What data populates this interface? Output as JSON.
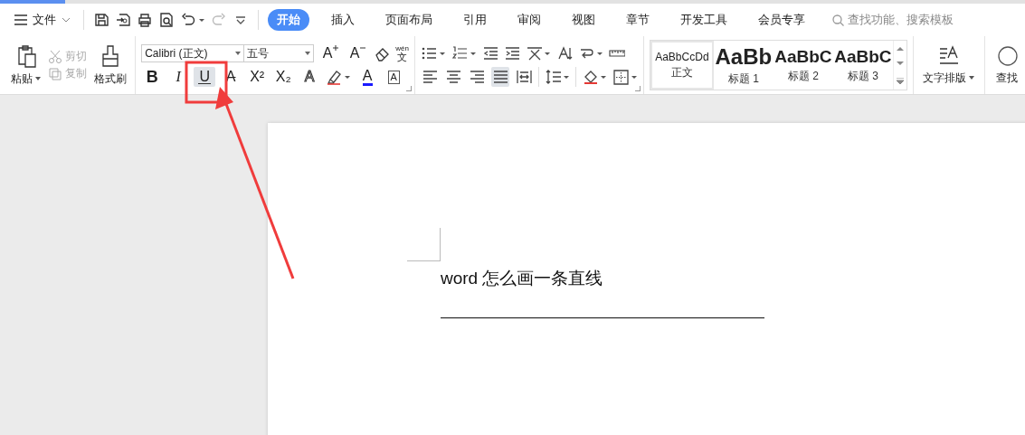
{
  "menu": {
    "file_label": "文件"
  },
  "tabs": [
    {
      "label": "开始",
      "selected": true
    },
    {
      "label": "插入",
      "selected": false
    },
    {
      "label": "页面布局",
      "selected": false
    },
    {
      "label": "引用",
      "selected": false
    },
    {
      "label": "审阅",
      "selected": false
    },
    {
      "label": "视图",
      "selected": false
    },
    {
      "label": "章节",
      "selected": false
    },
    {
      "label": "开发工具",
      "selected": false
    },
    {
      "label": "会员专享",
      "selected": false
    }
  ],
  "search": {
    "placeholder": "查找功能、搜索模板"
  },
  "clipboard": {
    "paste": "粘贴",
    "cut": {
      "label": "剪切",
      "disabled": true
    },
    "copy": {
      "label": "复制",
      "disabled": true
    },
    "format_painter": "格式刷"
  },
  "font": {
    "name": "Calibri (正文)",
    "size": "五号",
    "pinyin_top": "wén",
    "pinyin_bottom": "文",
    "grow": "A",
    "shrink": "A",
    "styles": [
      {
        "kind": "bold",
        "glyph": "B",
        "selected": false
      },
      {
        "kind": "italic",
        "glyph": "I",
        "selected": false
      },
      {
        "kind": "underline",
        "glyph": "U",
        "selected": true
      },
      {
        "kind": "strike",
        "glyph": "A",
        "selected": false
      },
      {
        "kind": "sup",
        "glyph": "X²",
        "selected": false
      },
      {
        "kind": "sub",
        "glyph": "X₂",
        "selected": false
      },
      {
        "kind": "effect",
        "glyph": "A",
        "selected": false
      },
      {
        "kind": "highlight",
        "selected": false
      },
      {
        "kind": "color",
        "glyph": "A",
        "selected": false
      },
      {
        "kind": "border",
        "glyph": "A",
        "selected": false
      }
    ]
  },
  "paragraph": {
    "align": [
      {
        "kind": "left",
        "selected": false
      },
      {
        "kind": "center",
        "selected": false
      },
      {
        "kind": "right",
        "selected": false
      },
      {
        "kind": "justify",
        "selected": true
      },
      {
        "kind": "distributed",
        "selected": false
      }
    ]
  },
  "styles_gallery": [
    {
      "preview": "AaBbCcDd",
      "label": "正文",
      "selected": true
    },
    {
      "preview": "AaBb",
      "label": "标题 1",
      "selected": false
    },
    {
      "preview": "AaBbC",
      "label": "标题 2",
      "selected": false
    },
    {
      "preview": "AaBbC",
      "label": "标题 3",
      "selected": false
    }
  ],
  "text_layout": "文字排版",
  "find": "查找",
  "document": {
    "title": "word 怎么画一条直线"
  }
}
